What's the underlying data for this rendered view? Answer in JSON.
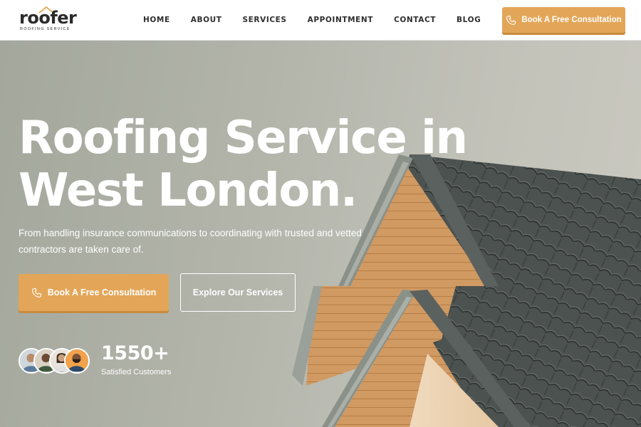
{
  "brand": {
    "name": "roofer",
    "tagline": "ROOFING SERVICE"
  },
  "nav": {
    "items": [
      "HOME",
      "ABOUT",
      "SERVICES",
      "APPOINTMENT",
      "CONTACT",
      "BLOG"
    ]
  },
  "header_cta": {
    "label": "Book A Free Consultation",
    "icon": "phone-icon"
  },
  "hero": {
    "title": "Roofing Service in\nWest London.",
    "subtitle": "From handling insurance communications to coordinating with trusted and vetted contractors are taken care of.",
    "primary_button": "Book A Free Consultation",
    "secondary_button": "Explore Our Services"
  },
  "stats": {
    "count": "1550+",
    "label": "Satisfied Customers"
  },
  "colors": {
    "accent": "#e3a658",
    "text_dark": "#2e2e2e",
    "white": "#ffffff"
  }
}
